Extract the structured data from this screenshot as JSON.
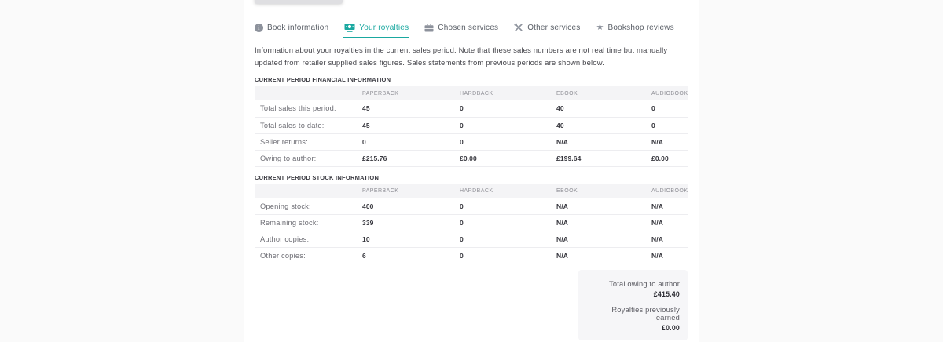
{
  "colors": {
    "accent": "#1aa8a0",
    "page_bg": "#fafafa",
    "card_bg": "#ffffff"
  },
  "tabs": [
    {
      "label": "Book information",
      "icon": "info-icon",
      "active": false
    },
    {
      "label": "Your royalties",
      "icon": "banknote-icon",
      "active": true
    },
    {
      "label": "Chosen services",
      "icon": "briefcase-icon",
      "active": false
    },
    {
      "label": "Other services",
      "icon": "tools-icon",
      "active": false
    },
    {
      "label": "Bookshop reviews",
      "icon": "star-icon",
      "active": false
    }
  ],
  "intro": "Information about your royalties in the current sales period. Note that these sales numbers are not real time but manually updated from retailer supplied sales figures. Sales statements from previous periods are shown below.",
  "financial": {
    "title": "CURRENT PERIOD FINANCIAL INFORMATION",
    "columns": [
      "",
      "PAPERBACK",
      "HARDBACK",
      "EBOOK",
      "AUDIOBOOK"
    ],
    "rows": [
      {
        "label": "Total sales this period:",
        "values": [
          "45",
          "0",
          "40",
          "0"
        ]
      },
      {
        "label": "Total sales to date:",
        "values": [
          "45",
          "0",
          "40",
          "0"
        ]
      },
      {
        "label": "Seller returns:",
        "values": [
          "0",
          "0",
          "N/A",
          "N/A"
        ]
      },
      {
        "label": "Owing to author:",
        "values": [
          "£215.76",
          "£0.00",
          "£199.64",
          "£0.00"
        ]
      }
    ]
  },
  "stock": {
    "title": "CURRENT PERIOD STOCK INFORMATION",
    "columns": [
      "",
      "PAPERBACK",
      "HARDBACK",
      "EBOOK",
      "AUDIOBOOK"
    ],
    "rows": [
      {
        "label": "Opening stock:",
        "values": [
          "400",
          "0",
          "N/A",
          "N/A"
        ]
      },
      {
        "label": "Remaining stock:",
        "values": [
          "339",
          "0",
          "N/A",
          "N/A"
        ]
      },
      {
        "label": "Author copies:",
        "values": [
          "10",
          "0",
          "N/A",
          "N/A"
        ]
      },
      {
        "label": "Other copies:",
        "values": [
          "6",
          "0",
          "N/A",
          "N/A"
        ]
      }
    ]
  },
  "summary": {
    "items": [
      {
        "label": "Total owing to author",
        "value": "£415.40"
      },
      {
        "label": "Royalties previously earned",
        "value": "£0.00"
      }
    ]
  }
}
